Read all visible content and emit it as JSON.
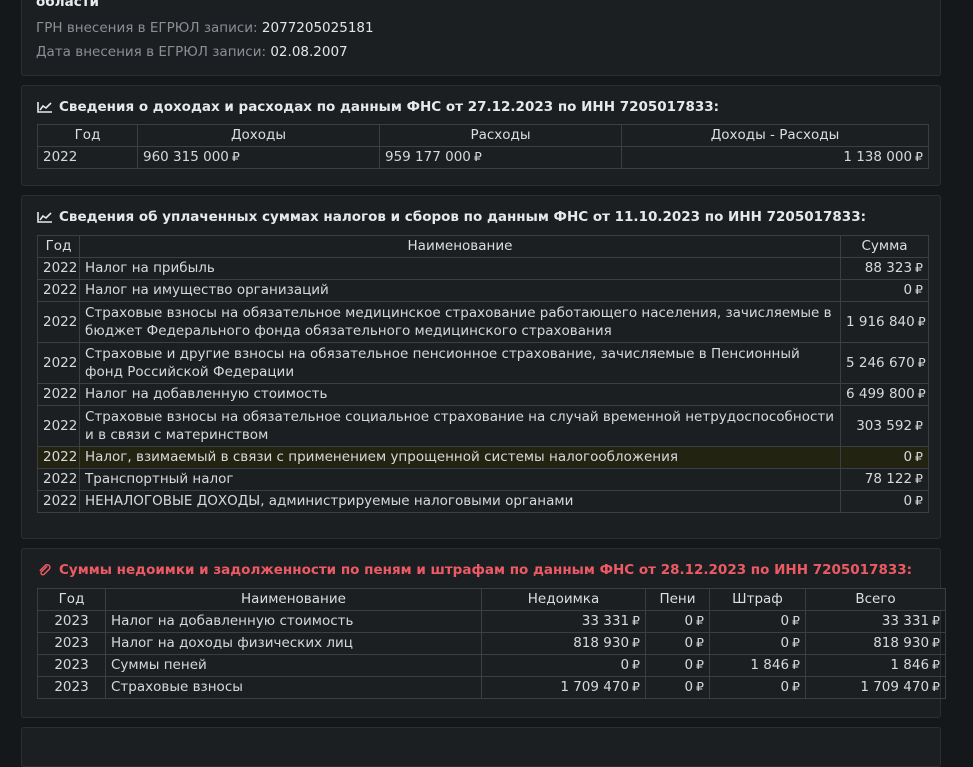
{
  "top": {
    "region_tail": "области",
    "grn_label": "ГРН внесения в ЕГРЮЛ записи:",
    "grn_value": "2077205025181",
    "date_label": "Дата внесения в ЕГРЮЛ записи:",
    "date_value": "02.08.2007"
  },
  "currency": "₽",
  "income": {
    "title": "Сведения о доходах и расходах по данным ФНС от 27.12.2023 по ИНН 7205017833:",
    "icon": "chart-line-icon",
    "headers": [
      "Год",
      "Доходы",
      "Расходы",
      "Доходы - Расходы"
    ],
    "rows": [
      {
        "year": "2022",
        "income": "960 315 000",
        "expense": "959 177 000",
        "diff": "1 138 000"
      }
    ]
  },
  "taxes": {
    "title": "Сведения об уплаченных суммах налогов и сборов по данным ФНС от 11.10.2023 по ИНН 7205017833:",
    "icon": "chart-line-icon",
    "headers": [
      "Год",
      "Наименование",
      "Сумма"
    ],
    "rows": [
      {
        "year": "2022",
        "name": "Налог на прибыль",
        "sum": "88 323"
      },
      {
        "year": "2022",
        "name": "Налог на имущество организаций",
        "sum": "0"
      },
      {
        "year": "2022",
        "name": "Страховые взносы на обязательное медицинское страхование работающего населения, зачисляемые в бюджет Федерального фонда обязательного медицинского страхования",
        "sum": "1 916 840"
      },
      {
        "year": "2022",
        "name": "Страховые и другие взносы на обязательное пенсионное страхование, зачисляемые в Пенсионный фонд Российской Федерации",
        "sum": "5 246 670"
      },
      {
        "year": "2022",
        "name": "Налог на добавленную стоимость",
        "sum": "6 499 800"
      },
      {
        "year": "2022",
        "name": "Страховые взносы на обязательное социальное страхование на случай временной нетрудоспособности и в связи с материнством",
        "sum": "303 592"
      },
      {
        "year": "2022",
        "name": "Налог, взимаемый в связи с применением упрощенной системы налогообложения",
        "sum": "0"
      },
      {
        "year": "2022",
        "name": "Транспортный налог",
        "sum": "78 122"
      },
      {
        "year": "2022",
        "name": "НЕНАЛОГОВЫЕ ДОХОДЫ, администрируемые налоговыми органами",
        "sum": "0"
      }
    ]
  },
  "debts": {
    "title": "Суммы недоимки и задолженности по пеням и штрафам по данным ФНС от 28.12.2023 по ИНН 7205017833:",
    "icon": "paperclip-icon",
    "title_color": "#ee5a64",
    "headers": [
      "Год",
      "Наименование",
      "Недоимка",
      "Пени",
      "Штраф",
      "Всего"
    ],
    "rows": [
      {
        "year": "2023",
        "name": "Налог на добавленную стоимость",
        "arrears": "33 331",
        "penalty": "0",
        "fine": "0",
        "total": "33 331"
      },
      {
        "year": "2023",
        "name": "Налог на доходы физических лиц",
        "arrears": "818 930",
        "penalty": "0",
        "fine": "0",
        "total": "818 930"
      },
      {
        "year": "2023",
        "name": "Суммы пеней",
        "arrears": "0",
        "penalty": "0",
        "fine": "1 846",
        "total": "1 846"
      },
      {
        "year": "2023",
        "name": "Страховые взносы",
        "arrears": "1 709 470",
        "penalty": "0",
        "fine": "0",
        "total": "1 709 470"
      }
    ]
  }
}
